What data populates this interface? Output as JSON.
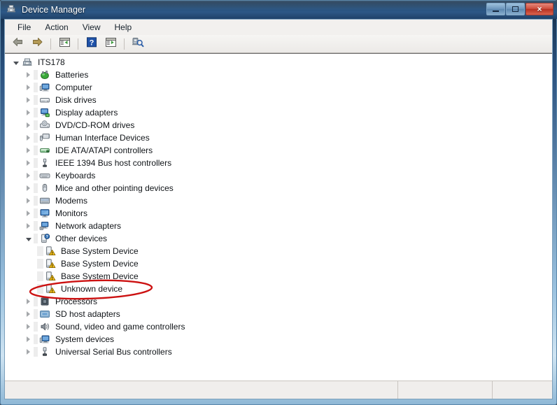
{
  "window": {
    "title": "Device Manager",
    "title_icon": "device-manager-icon",
    "caption": {
      "minimize_label": "Minimize",
      "maximize_label": "Maximize",
      "close_label": "×"
    }
  },
  "menu": {
    "items": [
      {
        "label": "File",
        "name": "menu-file"
      },
      {
        "label": "Action",
        "name": "menu-action"
      },
      {
        "label": "View",
        "name": "menu-view"
      },
      {
        "label": "Help",
        "name": "menu-help"
      }
    ]
  },
  "toolbar": {
    "buttons": [
      {
        "icon": "back-arrow-icon",
        "tooltip": "Back"
      },
      {
        "icon": "forward-arrow-icon",
        "tooltip": "Forward"
      },
      {
        "icon": "show-hide-console-tree-icon",
        "tooltip": "Show/Hide Console Tree"
      },
      {
        "icon": "help-icon",
        "tooltip": "Help"
      },
      {
        "icon": "properties-icon",
        "tooltip": "Properties"
      },
      {
        "icon": "scan-for-hardware-changes-icon",
        "tooltip": "Scan for hardware changes"
      }
    ]
  },
  "tree": {
    "root": {
      "label": "ITS178",
      "icon": "computer-root-icon",
      "expanded": true
    },
    "items": [
      {
        "label": "Batteries",
        "icon": "battery-icon",
        "level": 1,
        "expanded": false
      },
      {
        "label": "Computer",
        "icon": "computer-icon",
        "level": 1,
        "expanded": false
      },
      {
        "label": "Disk drives",
        "icon": "disk-drive-icon",
        "level": 1,
        "expanded": false
      },
      {
        "label": "Display adapters",
        "icon": "display-adapter-icon",
        "level": 1,
        "expanded": false
      },
      {
        "label": "DVD/CD-ROM drives",
        "icon": "dvd-drive-icon",
        "level": 1,
        "expanded": false
      },
      {
        "label": "Human Interface Devices",
        "icon": "hid-icon",
        "level": 1,
        "expanded": false
      },
      {
        "label": "IDE ATA/ATAPI controllers",
        "icon": "ide-controller-icon",
        "level": 1,
        "expanded": false
      },
      {
        "label": "IEEE 1394 Bus host controllers",
        "icon": "ieee1394-icon",
        "level": 1,
        "expanded": false
      },
      {
        "label": "Keyboards",
        "icon": "keyboard-icon",
        "level": 1,
        "expanded": false
      },
      {
        "label": "Mice and other pointing devices",
        "icon": "mouse-icon",
        "level": 1,
        "expanded": false
      },
      {
        "label": "Modems",
        "icon": "modem-icon",
        "level": 1,
        "expanded": false
      },
      {
        "label": "Monitors",
        "icon": "monitor-icon",
        "level": 1,
        "expanded": false
      },
      {
        "label": "Network adapters",
        "icon": "network-adapter-icon",
        "level": 1,
        "expanded": false
      },
      {
        "label": "Other devices",
        "icon": "other-device-icon",
        "level": 1,
        "expanded": true
      },
      {
        "label": "Base System Device",
        "icon": "unknown-device-warning-icon",
        "level": 2,
        "leaf": true
      },
      {
        "label": "Base System Device",
        "icon": "unknown-device-warning-icon",
        "level": 2,
        "leaf": true
      },
      {
        "label": "Base System Device",
        "icon": "unknown-device-warning-icon",
        "level": 2,
        "leaf": true
      },
      {
        "label": "Unknown device",
        "icon": "unknown-device-warning-icon",
        "level": 2,
        "leaf": true,
        "annotated": true
      },
      {
        "label": "Processors",
        "icon": "processor-icon",
        "level": 1,
        "expanded": false
      },
      {
        "label": "SD host adapters",
        "icon": "sd-host-adapter-icon",
        "level": 1,
        "expanded": false
      },
      {
        "label": "Sound, video and game controllers",
        "icon": "sound-controller-icon",
        "level": 1,
        "expanded": false
      },
      {
        "label": "System devices",
        "icon": "system-device-icon",
        "level": 1,
        "expanded": false
      },
      {
        "label": "Universal Serial Bus controllers",
        "icon": "usb-controller-icon",
        "level": 1,
        "expanded": false
      }
    ]
  },
  "annotation": {
    "name": "red-ellipse-highlight",
    "shape": "ellipse",
    "color": "#cc1111",
    "target_label": "Unknown device"
  },
  "statusbar": {
    "main_text": "",
    "pane_b_text": "",
    "pane_c_text": ""
  },
  "colors": {
    "title_bar": "#28527e",
    "close_button": "#cf4f3f",
    "panel_background": "#ffffff",
    "chrome_background": "#f0eeec",
    "annotation_red": "#cc1111"
  }
}
